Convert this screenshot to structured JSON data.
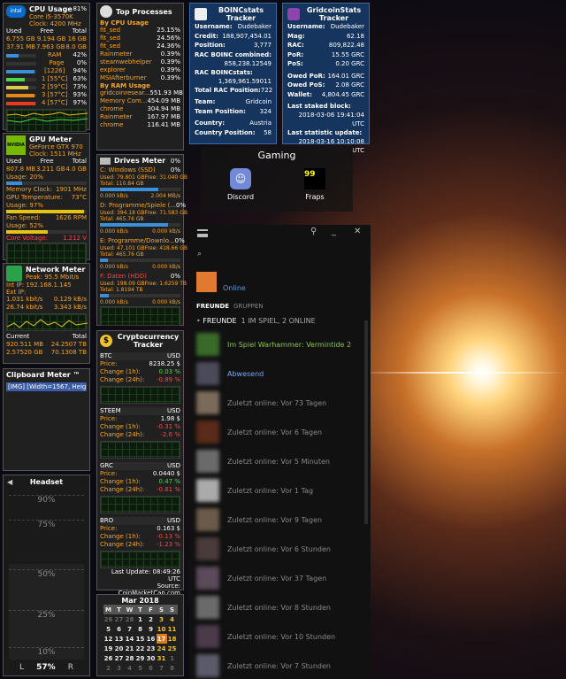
{
  "cpu": {
    "title": "CPU Usage",
    "percent": "81%",
    "brand": "intel",
    "model": "Core i5-3570K",
    "clock": "Clock: 4200 MHz",
    "headers": [
      "Used",
      "Free",
      "Total"
    ],
    "mem1": [
      "6.755 GB",
      "9.194 GB",
      "16 GB"
    ],
    "mem2": [
      "37.91 MB",
      "7.963 GB",
      "8.0 GB"
    ],
    "rows": [
      {
        "label": "RAM",
        "value": "42%"
      },
      {
        "label": "Page",
        "value": "0%"
      },
      {
        "label": "[1226]",
        "value": "94%"
      },
      {
        "label": "1 [55°C]",
        "value": "63%"
      },
      {
        "label": "2 [59°C]",
        "value": "73%"
      },
      {
        "label": "3 [57°C]",
        "value": "93%"
      },
      {
        "label": "4 [57°C]",
        "value": "97%"
      }
    ]
  },
  "gpu": {
    "title": "GPU Meter",
    "brand": "NVIDIA",
    "model": "GeForce GTX 970",
    "clock": "Clock: 1511 MHz",
    "headers": [
      "Used",
      "Free",
      "Total"
    ],
    "mem": [
      "807.8 MB",
      "3.211 GB",
      "4.0 GB"
    ],
    "usage": "Usage: 20%",
    "memory_clock_label": "Memory Clock:",
    "memory_clock": "1901 MHz",
    "temp_label": "GPU Temperature:",
    "temp": "73°C",
    "usage2": "Usage: 97%",
    "fan_label": "Fan Speed:",
    "fan": "1626 RPM",
    "usage3": "Usage: 52%",
    "voltage_label": "Core Voltage:",
    "voltage": "1.212 V"
  },
  "network": {
    "title": "Network Meter",
    "peak": "Peak: 95.5 Mbit/s",
    "int_ip": "Int IP: 192.168.1.145",
    "ext_ip": "Ext IP:",
    "down": [
      "1.031 kbit/s",
      "0.129 kB/s"
    ],
    "up": [
      "26.74 kbit/s",
      "3.343 kB/s"
    ],
    "current_label": "Current",
    "total_label": "Total",
    "total_down": [
      "920.511 MB",
      "24.2507 TB"
    ],
    "total_up": [
      "2.57520 GB",
      "70.1308 TB"
    ]
  },
  "clipboard": {
    "title": "Clipboard Meter ™",
    "item": "[IMG] [Width=1567, Height..."
  },
  "headset": {
    "title": "Headset",
    "ticks": [
      "90%",
      "75%",
      "50%",
      "25%",
      "10%"
    ],
    "left": "L",
    "value": "57%",
    "right": "R",
    "level": 0.57
  },
  "top": {
    "title": "Top Processes",
    "cpu_header": "By CPU Usage",
    "cpu": [
      [
        "fit_sed",
        "25.15%"
      ],
      [
        "fit_sed",
        "24.56%"
      ],
      [
        "fit_sed",
        "24.36%"
      ],
      [
        "Rainmeter",
        "0.39%"
      ],
      [
        "steamwebhelper",
        "0.39%"
      ],
      [
        "explorer",
        "0.39%"
      ],
      [
        "MSIAfterburner",
        "0.39%"
      ]
    ],
    "ram_header": "By RAM Usage",
    "ram": [
      [
        "gridcoinresear...",
        "551.93 MB"
      ],
      [
        "Memory Com...",
        "454.09 MB"
      ],
      [
        "chrome",
        "304.94 MB"
      ],
      [
        "Rainmeter",
        "167.97 MB"
      ],
      [
        "chrome",
        "116.41 MB"
      ]
    ]
  },
  "drives": {
    "title": "Drives Meter",
    "percent": "0%",
    "list": [
      {
        "name": "C: Windows (SSD)",
        "pct": "0%",
        "used": "Used: 79.801 GB",
        "free": "Free: 31.040 GB",
        "total": "Total: 110.84 GB",
        "r": "0.000 kB/s",
        "w": "2.004 MB/s",
        "fill": 0.72
      },
      {
        "name": "D: Programme/Spiele (...",
        "pct": "0%",
        "used": "Used: 394.18 GB",
        "free": "Free: 71.583 GB",
        "total": "Total: 465.76 GB",
        "r": "0.000 kB/s",
        "w": "0.000 kB/s",
        "fill": 0.85
      },
      {
        "name": "E: Programme/Downlo...",
        "pct": "0%",
        "used": "Used: 47.101 GB",
        "free": "Free: 418.66 GB",
        "total": "Total: 465.76 GB",
        "r": "0.000 kB/s",
        "w": "0.000 kB/s",
        "fill": 0.1
      },
      {
        "name": "F: Daten (HDD)",
        "pct": "0%",
        "used": "Used: 198.09 GB",
        "free": "Free: 1.6259 TB",
        "total": "Total: 1.8194 TB",
        "r": "0.000 kB/s",
        "w": "0.000 kB/s",
        "fill": 0.11
      }
    ]
  },
  "crypto": {
    "title": "Cryptocurrency Tracker",
    "coins": [
      {
        "sym": "BTC",
        "cur": "USD",
        "price": "8238.25 $",
        "c1": "0.03 %",
        "c24": "-0.89 %",
        "c1pos": true
      },
      {
        "sym": "STEEM",
        "cur": "USD",
        "price": "1.98 $",
        "c1": "-0.31 %",
        "c24": "-2.6 %",
        "c1pos": false
      },
      {
        "sym": "GRC",
        "cur": "USD",
        "price": "0.0440 $",
        "c1": "0.47 %",
        "c24": "-0.81 %",
        "c1pos": true
      },
      {
        "sym": "BRO",
        "cur": "USD",
        "price": "0.163 $",
        "c1": "-0.13 %",
        "c24": "-1.23 %",
        "c1pos": false
      }
    ],
    "labels": {
      "price": "Price:",
      "c1": "Change (1h):",
      "c24": "Change (24h):"
    },
    "updated": "Last Update: 08:49:26 UTC",
    "source": "Source: CoinMarketCap.com"
  },
  "calendar": {
    "month": "Mar 2018",
    "days": [
      "M",
      "T",
      "W",
      "T",
      "F",
      "S",
      "S"
    ],
    "weeks": [
      [
        "26",
        "27",
        "28",
        "1",
        "2",
        "3",
        "4"
      ],
      [
        "5",
        "6",
        "7",
        "8",
        "9",
        "10",
        "11"
      ],
      [
        "12",
        "13",
        "14",
        "15",
        "16",
        "17",
        "18"
      ],
      [
        "19",
        "20",
        "21",
        "22",
        "23",
        "24",
        "25"
      ],
      [
        "26",
        "27",
        "28",
        "29",
        "30",
        "31",
        "1"
      ],
      [
        "2",
        "3",
        "4",
        "5",
        "6",
        "7",
        "8"
      ]
    ],
    "today": "17"
  },
  "boinc": {
    "title": "BOINCstats Tracker",
    "rows": [
      [
        "Username:",
        "Dudebaker"
      ],
      [
        "Credit:",
        "188,907,454.01"
      ],
      [
        "Position:",
        "3,777"
      ]
    ],
    "combined_label": "RAC BOINC combined:",
    "combined": "858,238.12549",
    "credit_label": "RAC BOINCstats:",
    "credit": "1,369,961.59011",
    "total_rac": [
      "Total RAC Position:",
      "722"
    ],
    "team": [
      [
        "Team:",
        "Gridcoin"
      ],
      [
        "Team Position:",
        "324"
      ]
    ],
    "country": [
      [
        "Country:",
        "Austria"
      ],
      [
        "Country Position:",
        "58"
      ]
    ]
  },
  "grc": {
    "title": "GridcoinStats Tracker",
    "rows": [
      [
        "Username:",
        "Dudebaker"
      ],
      [
        "Mag:",
        "62.18"
      ],
      [
        "RAC:",
        "809,822.48"
      ],
      [
        "PoR:",
        "15.55 GRC"
      ],
      [
        "PoS:",
        "0.20 GRC"
      ]
    ],
    "owed": [
      [
        "Owed PoR:",
        "164.01 GRC"
      ],
      [
        "Owed PoS:",
        "2.08 GRC"
      ],
      [
        "Wallet:",
        "4,804.45 GRC"
      ]
    ],
    "staked_label": "Last staked block:",
    "staked": "2018-03-06 19:41:04 UTC",
    "stat_label": "Last statistic update:",
    "stat": "2018-03-16 10:10:08 UTC"
  },
  "gaming": {
    "title": "Gaming",
    "apps": [
      {
        "label": "Discord"
      },
      {
        "label": "Fraps"
      }
    ],
    "fraps_badge": "99"
  },
  "discord": {
    "status": "Online",
    "tab_friends": "FREUNDE",
    "tab_groups": "GRUPPEN",
    "section": "FREUNDE",
    "section_count": "1 IM SPIEL, 2 ONLINE",
    "friends": [
      {
        "text": "Im Spiel Warhammer: Vermintide 2",
        "color": "#8bc34a"
      },
      {
        "text": "Abwesend",
        "color": "#7aa8ff"
      },
      {
        "text": "Zuletzt online: Vor 73 Tagen",
        "color": "#888"
      },
      {
        "text": "Zuletzt online: Vor 6 Tagen",
        "color": "#888"
      },
      {
        "text": "Zuletzt online: Vor 5 Minuten",
        "color": "#888"
      },
      {
        "text": "Zuletzt online: Vor 1 Tag",
        "color": "#888"
      },
      {
        "text": "Zuletzt online: Vor 9 Tagen",
        "color": "#888"
      },
      {
        "text": "Zuletzt online: Vor 6 Stunden",
        "color": "#888"
      },
      {
        "text": "Zuletzt online: Vor 37 Tagen",
        "color": "#888"
      },
      {
        "text": "Zuletzt online: Vor 8 Stunden",
        "color": "#888"
      },
      {
        "text": "Zuletzt online: Vor 10 Stunden",
        "color": "#888"
      },
      {
        "text": "Zuletzt online: Vor 7 Stunden",
        "color": "#888"
      }
    ]
  }
}
